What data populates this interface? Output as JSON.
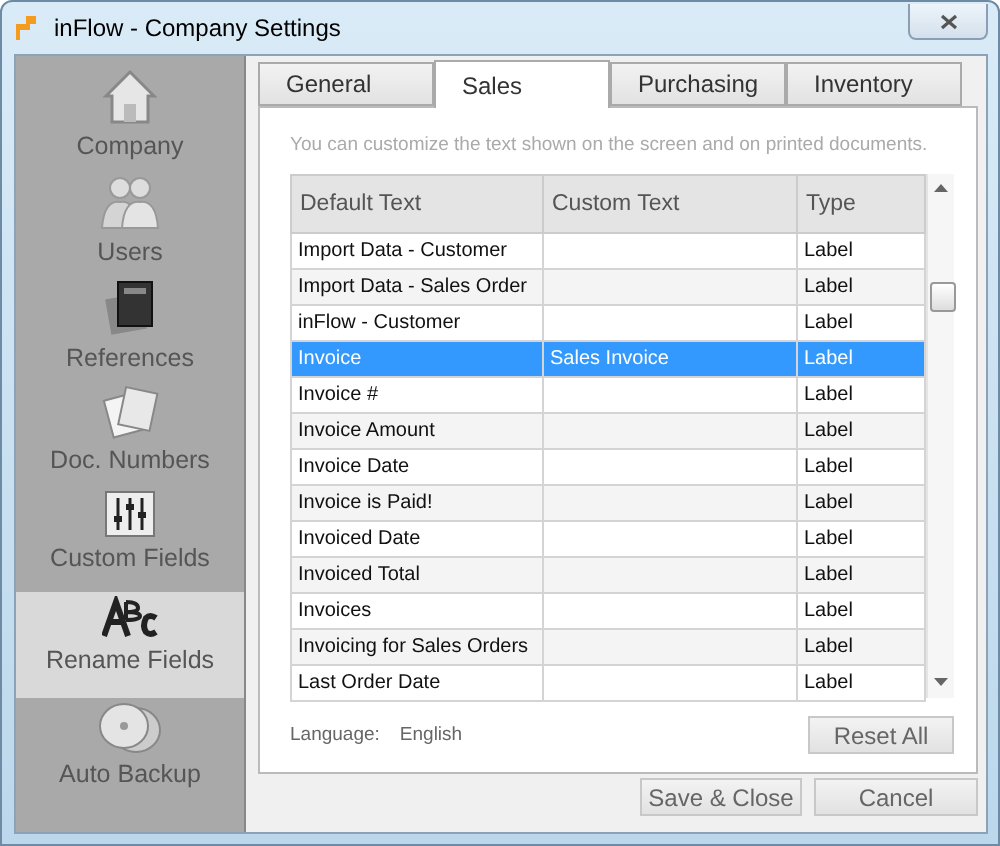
{
  "window": {
    "title": "inFlow - Company Settings"
  },
  "sidebar": {
    "items": [
      {
        "label": "Company",
        "selected": false
      },
      {
        "label": "Users",
        "selected": false
      },
      {
        "label": "References",
        "selected": false
      },
      {
        "label": "Doc. Numbers",
        "selected": false
      },
      {
        "label": "Custom Fields",
        "selected": false
      },
      {
        "label": "Rename Fields",
        "selected": true
      },
      {
        "label": "Auto Backup",
        "selected": false
      }
    ]
  },
  "tabs": [
    {
      "label": "General",
      "selected": false
    },
    {
      "label": "Sales",
      "selected": true
    },
    {
      "label": "Purchasing",
      "selected": false
    },
    {
      "label": "Inventory",
      "selected": false
    }
  ],
  "hint": "You can customize the text shown on the screen and on printed documents.",
  "table": {
    "columns": [
      "Default Text",
      "Custom Text",
      "Type"
    ],
    "rows": [
      {
        "cells": [
          "Import Data - Customer",
          "",
          "Label"
        ],
        "selected": false
      },
      {
        "cells": [
          "Import Data - Sales Order",
          "",
          "Label"
        ],
        "selected": false
      },
      {
        "cells": [
          "inFlow - Customer",
          "",
          "Label"
        ],
        "selected": false
      },
      {
        "cells": [
          "Invoice",
          "Sales Invoice",
          "Label"
        ],
        "selected": true
      },
      {
        "cells": [
          "Invoice #",
          "",
          "Label"
        ],
        "selected": false
      },
      {
        "cells": [
          "Invoice Amount",
          "",
          "Label"
        ],
        "selected": false
      },
      {
        "cells": [
          "Invoice Date",
          "",
          "Label"
        ],
        "selected": false
      },
      {
        "cells": [
          "Invoice is Paid!",
          "",
          "Label"
        ],
        "selected": false
      },
      {
        "cells": [
          "Invoiced Date",
          "",
          "Label"
        ],
        "selected": false
      },
      {
        "cells": [
          "Invoiced Total",
          "",
          "Label"
        ],
        "selected": false
      },
      {
        "cells": [
          "Invoices",
          "",
          "Label"
        ],
        "selected": false
      },
      {
        "cells": [
          "Invoicing for Sales Orders",
          "",
          "Label"
        ],
        "selected": false
      },
      {
        "cells": [
          "Last Order Date",
          "",
          "Label"
        ],
        "selected": false
      }
    ]
  },
  "language": {
    "label": "Language:",
    "value": "English"
  },
  "reset_button": "Reset All",
  "buttons": [
    "Save & Close",
    "Cancel"
  ]
}
